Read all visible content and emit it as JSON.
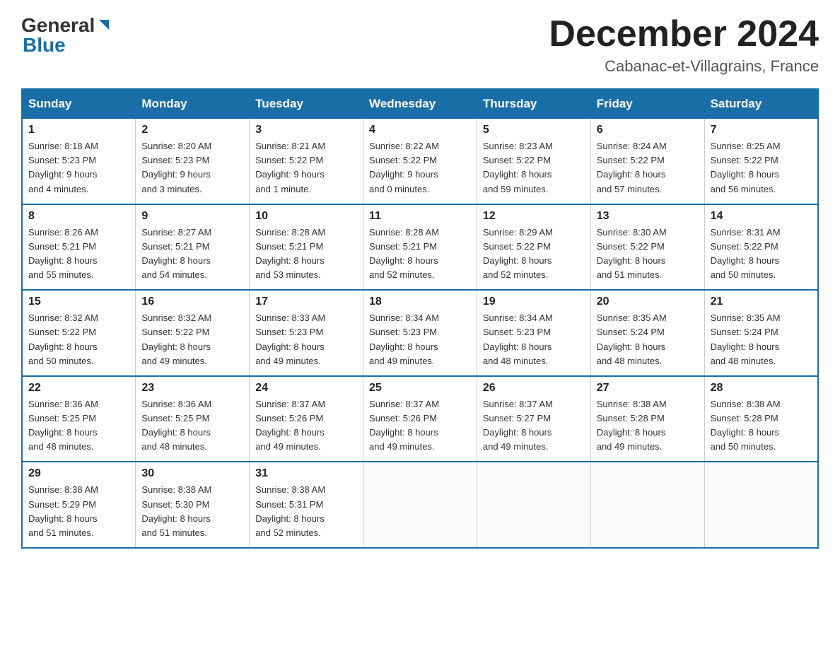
{
  "header": {
    "month_title": "December 2024",
    "location": "Cabanac-et-Villagrains, France",
    "logo_general": "General",
    "logo_blue": "Blue"
  },
  "days_of_week": [
    "Sunday",
    "Monday",
    "Tuesday",
    "Wednesday",
    "Thursday",
    "Friday",
    "Saturday"
  ],
  "weeks": [
    [
      {
        "day": "1",
        "sunrise": "Sunrise: 8:18 AM",
        "sunset": "Sunset: 5:23 PM",
        "daylight": "Daylight: 9 hours",
        "minutes": "and 4 minutes."
      },
      {
        "day": "2",
        "sunrise": "Sunrise: 8:20 AM",
        "sunset": "Sunset: 5:23 PM",
        "daylight": "Daylight: 9 hours",
        "minutes": "and 3 minutes."
      },
      {
        "day": "3",
        "sunrise": "Sunrise: 8:21 AM",
        "sunset": "Sunset: 5:22 PM",
        "daylight": "Daylight: 9 hours",
        "minutes": "and 1 minute."
      },
      {
        "day": "4",
        "sunrise": "Sunrise: 8:22 AM",
        "sunset": "Sunset: 5:22 PM",
        "daylight": "Daylight: 9 hours",
        "minutes": "and 0 minutes."
      },
      {
        "day": "5",
        "sunrise": "Sunrise: 8:23 AM",
        "sunset": "Sunset: 5:22 PM",
        "daylight": "Daylight: 8 hours",
        "minutes": "and 59 minutes."
      },
      {
        "day": "6",
        "sunrise": "Sunrise: 8:24 AM",
        "sunset": "Sunset: 5:22 PM",
        "daylight": "Daylight: 8 hours",
        "minutes": "and 57 minutes."
      },
      {
        "day": "7",
        "sunrise": "Sunrise: 8:25 AM",
        "sunset": "Sunset: 5:22 PM",
        "daylight": "Daylight: 8 hours",
        "minutes": "and 56 minutes."
      }
    ],
    [
      {
        "day": "8",
        "sunrise": "Sunrise: 8:26 AM",
        "sunset": "Sunset: 5:21 PM",
        "daylight": "Daylight: 8 hours",
        "minutes": "and 55 minutes."
      },
      {
        "day": "9",
        "sunrise": "Sunrise: 8:27 AM",
        "sunset": "Sunset: 5:21 PM",
        "daylight": "Daylight: 8 hours",
        "minutes": "and 54 minutes."
      },
      {
        "day": "10",
        "sunrise": "Sunrise: 8:28 AM",
        "sunset": "Sunset: 5:21 PM",
        "daylight": "Daylight: 8 hours",
        "minutes": "and 53 minutes."
      },
      {
        "day": "11",
        "sunrise": "Sunrise: 8:28 AM",
        "sunset": "Sunset: 5:21 PM",
        "daylight": "Daylight: 8 hours",
        "minutes": "and 52 minutes."
      },
      {
        "day": "12",
        "sunrise": "Sunrise: 8:29 AM",
        "sunset": "Sunset: 5:22 PM",
        "daylight": "Daylight: 8 hours",
        "minutes": "and 52 minutes."
      },
      {
        "day": "13",
        "sunrise": "Sunrise: 8:30 AM",
        "sunset": "Sunset: 5:22 PM",
        "daylight": "Daylight: 8 hours",
        "minutes": "and 51 minutes."
      },
      {
        "day": "14",
        "sunrise": "Sunrise: 8:31 AM",
        "sunset": "Sunset: 5:22 PM",
        "daylight": "Daylight: 8 hours",
        "minutes": "and 50 minutes."
      }
    ],
    [
      {
        "day": "15",
        "sunrise": "Sunrise: 8:32 AM",
        "sunset": "Sunset: 5:22 PM",
        "daylight": "Daylight: 8 hours",
        "minutes": "and 50 minutes."
      },
      {
        "day": "16",
        "sunrise": "Sunrise: 8:32 AM",
        "sunset": "Sunset: 5:22 PM",
        "daylight": "Daylight: 8 hours",
        "minutes": "and 49 minutes."
      },
      {
        "day": "17",
        "sunrise": "Sunrise: 8:33 AM",
        "sunset": "Sunset: 5:23 PM",
        "daylight": "Daylight: 8 hours",
        "minutes": "and 49 minutes."
      },
      {
        "day": "18",
        "sunrise": "Sunrise: 8:34 AM",
        "sunset": "Sunset: 5:23 PM",
        "daylight": "Daylight: 8 hours",
        "minutes": "and 49 minutes."
      },
      {
        "day": "19",
        "sunrise": "Sunrise: 8:34 AM",
        "sunset": "Sunset: 5:23 PM",
        "daylight": "Daylight: 8 hours",
        "minutes": "and 48 minutes."
      },
      {
        "day": "20",
        "sunrise": "Sunrise: 8:35 AM",
        "sunset": "Sunset: 5:24 PM",
        "daylight": "Daylight: 8 hours",
        "minutes": "and 48 minutes."
      },
      {
        "day": "21",
        "sunrise": "Sunrise: 8:35 AM",
        "sunset": "Sunset: 5:24 PM",
        "daylight": "Daylight: 8 hours",
        "minutes": "and 48 minutes."
      }
    ],
    [
      {
        "day": "22",
        "sunrise": "Sunrise: 8:36 AM",
        "sunset": "Sunset: 5:25 PM",
        "daylight": "Daylight: 8 hours",
        "minutes": "and 48 minutes."
      },
      {
        "day": "23",
        "sunrise": "Sunrise: 8:36 AM",
        "sunset": "Sunset: 5:25 PM",
        "daylight": "Daylight: 8 hours",
        "minutes": "and 48 minutes."
      },
      {
        "day": "24",
        "sunrise": "Sunrise: 8:37 AM",
        "sunset": "Sunset: 5:26 PM",
        "daylight": "Daylight: 8 hours",
        "minutes": "and 49 minutes."
      },
      {
        "day": "25",
        "sunrise": "Sunrise: 8:37 AM",
        "sunset": "Sunset: 5:26 PM",
        "daylight": "Daylight: 8 hours",
        "minutes": "and 49 minutes."
      },
      {
        "day": "26",
        "sunrise": "Sunrise: 8:37 AM",
        "sunset": "Sunset: 5:27 PM",
        "daylight": "Daylight: 8 hours",
        "minutes": "and 49 minutes."
      },
      {
        "day": "27",
        "sunrise": "Sunrise: 8:38 AM",
        "sunset": "Sunset: 5:28 PM",
        "daylight": "Daylight: 8 hours",
        "minutes": "and 49 minutes."
      },
      {
        "day": "28",
        "sunrise": "Sunrise: 8:38 AM",
        "sunset": "Sunset: 5:28 PM",
        "daylight": "Daylight: 8 hours",
        "minutes": "and 50 minutes."
      }
    ],
    [
      {
        "day": "29",
        "sunrise": "Sunrise: 8:38 AM",
        "sunset": "Sunset: 5:29 PM",
        "daylight": "Daylight: 8 hours",
        "minutes": "and 51 minutes."
      },
      {
        "day": "30",
        "sunrise": "Sunrise: 8:38 AM",
        "sunset": "Sunset: 5:30 PM",
        "daylight": "Daylight: 8 hours",
        "minutes": "and 51 minutes."
      },
      {
        "day": "31",
        "sunrise": "Sunrise: 8:38 AM",
        "sunset": "Sunset: 5:31 PM",
        "daylight": "Daylight: 8 hours",
        "minutes": "and 52 minutes."
      },
      null,
      null,
      null,
      null
    ]
  ]
}
